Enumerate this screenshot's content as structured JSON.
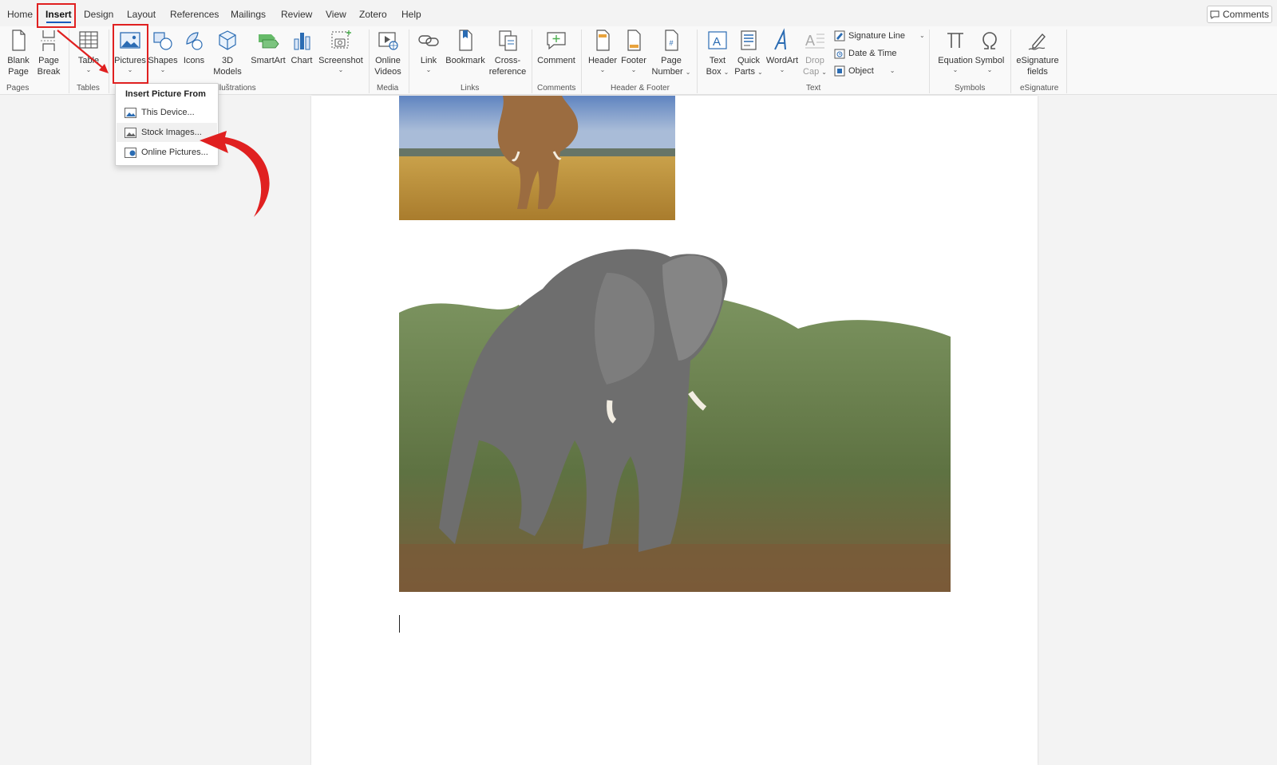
{
  "tabs": {
    "home": "Home",
    "insert": "Insert",
    "design": "Design",
    "layout": "Layout",
    "references": "References",
    "mailings": "Mailings",
    "review": "Review",
    "view": "View",
    "zotero": "Zotero",
    "help": "Help"
  },
  "comments_button": "Comments",
  "ribbon": {
    "blank_page": [
      "Blank",
      "Page"
    ],
    "page_break": [
      "Page",
      "Break"
    ],
    "table": "Table",
    "pictures": "Pictures",
    "shapes": "Shapes",
    "icons": "Icons",
    "models_3d": [
      "3D",
      "Models"
    ],
    "smartart": "SmartArt",
    "chart": "Chart",
    "screenshot": "Screenshot",
    "online_videos": [
      "Online",
      "Videos"
    ],
    "link": "Link",
    "bookmark": "Bookmark",
    "cross_reference": [
      "Cross-",
      "reference"
    ],
    "comment": "Comment",
    "header": "Header",
    "footer": "Footer",
    "page_number": [
      "Page",
      "Number"
    ],
    "text_box": [
      "Text",
      "Box"
    ],
    "quick_parts": [
      "Quick",
      "Parts"
    ],
    "wordart": "WordArt",
    "drop_cap": [
      "Drop",
      "Cap"
    ],
    "signature_line": "Signature Line",
    "date_time": "Date & Time",
    "object": "Object",
    "equation": "Equation",
    "symbol": "Symbol",
    "esignature_fields": [
      "eSignature",
      "fields"
    ]
  },
  "groups": {
    "pages": "Pages",
    "tables": "Tables",
    "illustrations": "Illustrations",
    "media": "Media",
    "links": "Links",
    "comments": "Comments",
    "header_footer": "Header & Footer",
    "text": "Text",
    "symbols": "Symbols",
    "esignature": "eSignature"
  },
  "dropdown": {
    "title": "Insert Picture From",
    "items": [
      "This Device...",
      "Stock Images...",
      "Online Pictures..."
    ]
  },
  "colors": {
    "accent": "#185abd",
    "annotation_red": "#e02020"
  },
  "icons": [
    "blank-page-icon",
    "page-break-icon",
    "table-icon",
    "pictures-icon",
    "shapes-icon",
    "icons-icon",
    "3d-models-icon",
    "smartart-icon",
    "chart-icon",
    "screenshot-icon",
    "online-videos-icon",
    "link-icon",
    "bookmark-icon",
    "cross-reference-icon",
    "comment-icon",
    "header-icon",
    "footer-icon",
    "page-number-icon",
    "text-box-icon",
    "quick-parts-icon",
    "wordart-icon",
    "drop-cap-icon",
    "signature-line-icon",
    "date-time-icon",
    "object-icon",
    "equation-icon",
    "symbol-icon",
    "esignature-icon"
  ]
}
